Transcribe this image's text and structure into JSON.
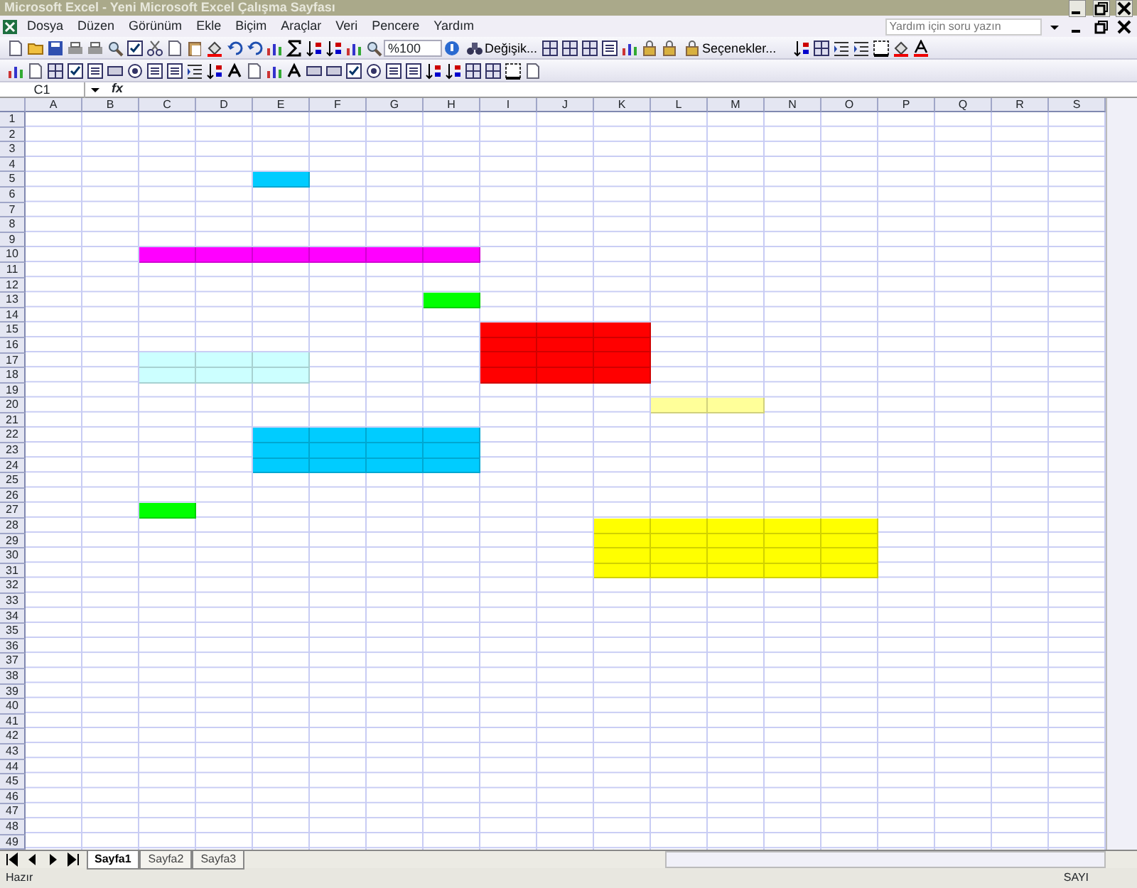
{
  "window": {
    "title": "Microsoft Excel - Yeni Microsoft Excel Çalışma Sayfası"
  },
  "menu": [
    "Dosya",
    "Düzen",
    "Görünüm",
    "Ekle",
    "Biçim",
    "Araçlar",
    "Veri",
    "Pencere",
    "Yardım"
  ],
  "help_box": {
    "placeholder": "Yardım için soru yazın"
  },
  "toolbar": {
    "zoom": "%100",
    "find_button": "Değişik...",
    "options_button": "Seçenekler..."
  },
  "formula_bar": {
    "name_box": "C1",
    "fx": "fx"
  },
  "columns": [
    "A",
    "B",
    "C",
    "D",
    "E",
    "F",
    "G",
    "H",
    "I",
    "J",
    "K",
    "L",
    "M",
    "N",
    "O",
    "P",
    "Q",
    "R",
    "S"
  ],
  "rows": [
    {
      "label": "1"
    },
    {
      "label": "2"
    },
    {
      "label": "3"
    },
    {
      "label": "4"
    },
    {
      "label": "5",
      "cells": [
        null,
        null,
        null,
        null,
        {
          "color": "#00ccff"
        },
        null,
        null,
        null,
        null,
        null,
        null,
        null,
        null,
        null,
        null,
        null,
        null,
        null,
        null
      ]
    },
    {
      "label": "6"
    },
    {
      "label": "7"
    },
    {
      "label": "8"
    },
    {
      "label": "9"
    },
    {
      "label": "10",
      "cells": [
        null,
        null,
        {
          "color": "#ff00ff"
        },
        {
          "color": "#ff00ff"
        },
        {
          "color": "#ff00ff"
        },
        {
          "color": "#ff00ff"
        },
        {
          "color": "#ff00ff"
        },
        {
          "color": "#ff00ff"
        },
        null,
        null,
        null,
        null,
        null,
        null,
        null,
        null,
        null,
        null,
        null
      ]
    },
    {
      "label": "11"
    },
    {
      "label": "12"
    },
    {
      "label": "13",
      "cells": [
        null,
        null,
        null,
        null,
        null,
        null,
        null,
        {
          "color": "#00ff00"
        },
        null,
        null,
        null,
        null,
        null,
        null,
        null,
        null,
        null,
        null,
        null
      ]
    },
    {
      "label": "14"
    },
    {
      "label": "15",
      "cells": [
        null,
        null,
        null,
        null,
        null,
        null,
        null,
        null,
        {
          "color": "#ff0000"
        },
        {
          "color": "#ff0000"
        },
        {
          "color": "#ff0000"
        },
        null,
        null,
        null,
        null,
        null,
        null,
        null,
        null
      ]
    },
    {
      "label": "16",
      "cells": [
        null,
        null,
        null,
        null,
        null,
        null,
        null,
        null,
        {
          "color": "#ff0000"
        },
        {
          "color": "#ff0000"
        },
        {
          "color": "#ff0000"
        },
        null,
        null,
        null,
        null,
        null,
        null,
        null,
        null
      ]
    },
    {
      "label": "17",
      "cells": [
        null,
        null,
        {
          "color": "#ccffff"
        },
        {
          "color": "#ccffff"
        },
        {
          "color": "#ccffff"
        },
        null,
        null,
        null,
        {
          "color": "#ff0000"
        },
        {
          "color": "#ff0000"
        },
        {
          "color": "#ff0000"
        },
        null,
        null,
        null,
        null,
        null,
        null,
        null,
        null
      ]
    },
    {
      "label": "18",
      "cells": [
        null,
        null,
        {
          "color": "#ccffff"
        },
        {
          "color": "#ccffff"
        },
        {
          "color": "#ccffff"
        },
        null,
        null,
        null,
        {
          "color": "#ff0000"
        },
        {
          "color": "#ff0000"
        },
        {
          "color": "#ff0000"
        },
        null,
        null,
        null,
        null,
        null,
        null,
        null,
        null
      ]
    },
    {
      "label": "19"
    },
    {
      "label": "20",
      "cells": [
        null,
        null,
        null,
        null,
        null,
        null,
        null,
        null,
        null,
        null,
        null,
        {
          "color": "#ffff99"
        },
        {
          "color": "#ffff99"
        },
        null,
        null,
        null,
        null,
        null,
        null
      ]
    },
    {
      "label": "21"
    },
    {
      "label": "22",
      "cells": [
        null,
        null,
        null,
        null,
        {
          "color": "#00ccff"
        },
        {
          "color": "#00ccff"
        },
        {
          "color": "#00ccff"
        },
        {
          "color": "#00ccff"
        },
        null,
        null,
        null,
        null,
        null,
        null,
        null,
        null,
        null,
        null,
        null
      ]
    },
    {
      "label": "23",
      "cells": [
        null,
        null,
        null,
        null,
        {
          "color": "#00ccff"
        },
        {
          "color": "#00ccff"
        },
        {
          "color": "#00ccff"
        },
        {
          "color": "#00ccff"
        },
        null,
        null,
        null,
        null,
        null,
        null,
        null,
        null,
        null,
        null,
        null
      ]
    },
    {
      "label": "24",
      "cells": [
        null,
        null,
        null,
        null,
        {
          "color": "#00ccff"
        },
        {
          "color": "#00ccff"
        },
        {
          "color": "#00ccff"
        },
        {
          "color": "#00ccff"
        },
        null,
        null,
        null,
        null,
        null,
        null,
        null,
        null,
        null,
        null,
        null
      ]
    },
    {
      "label": "25"
    },
    {
      "label": "26"
    },
    {
      "label": "27",
      "cells": [
        null,
        null,
        {
          "color": "#00ff00"
        },
        null,
        null,
        null,
        null,
        null,
        null,
        null,
        null,
        null,
        null,
        null,
        null,
        null,
        null,
        null,
        null
      ]
    },
    {
      "label": "28",
      "cells": [
        null,
        null,
        null,
        null,
        null,
        null,
        null,
        null,
        null,
        null,
        {
          "color": "#ffff00"
        },
        {
          "color": "#ffff00"
        },
        {
          "color": "#ffff00"
        },
        {
          "color": "#ffff00"
        },
        {
          "color": "#ffff00"
        },
        null,
        null,
        null,
        null
      ]
    },
    {
      "label": "29",
      "cells": [
        null,
        null,
        null,
        null,
        null,
        null,
        null,
        null,
        null,
        null,
        {
          "color": "#ffff00"
        },
        {
          "color": "#ffff00"
        },
        {
          "color": "#ffff00"
        },
        {
          "color": "#ffff00"
        },
        {
          "color": "#ffff00"
        },
        null,
        null,
        null,
        null
      ]
    },
    {
      "label": "30",
      "cells": [
        null,
        null,
        null,
        null,
        null,
        null,
        null,
        null,
        null,
        null,
        {
          "color": "#ffff00"
        },
        {
          "color": "#ffff00"
        },
        {
          "color": "#ffff00"
        },
        {
          "color": "#ffff00"
        },
        {
          "color": "#ffff00"
        },
        null,
        null,
        null,
        null
      ]
    },
    {
      "label": "31",
      "cells": [
        null,
        null,
        null,
        null,
        null,
        null,
        null,
        null,
        null,
        null,
        {
          "color": "#ffff00"
        },
        {
          "color": "#ffff00"
        },
        {
          "color": "#ffff00"
        },
        {
          "color": "#ffff00"
        },
        {
          "color": "#ffff00"
        },
        null,
        null,
        null,
        null
      ]
    },
    {
      "label": "32"
    },
    {
      "label": "33"
    },
    {
      "label": "34"
    },
    {
      "label": "35"
    },
    {
      "label": "36"
    },
    {
      "label": "37"
    },
    {
      "label": "38"
    },
    {
      "label": "39"
    },
    {
      "label": "40"
    },
    {
      "label": "41"
    },
    {
      "label": "42"
    },
    {
      "label": "43"
    },
    {
      "label": "44"
    },
    {
      "label": "45"
    },
    {
      "label": "46"
    },
    {
      "label": "47"
    },
    {
      "label": "48"
    },
    {
      "label": "49"
    }
  ],
  "sheet_tabs": [
    {
      "label": "Sayfa1",
      "selected": true
    },
    {
      "label": "Sayfa2",
      "selected": false
    },
    {
      "label": "Sayfa3",
      "selected": false
    }
  ],
  "status_bar": {
    "left": "Hazır",
    "right": "SAYI"
  }
}
